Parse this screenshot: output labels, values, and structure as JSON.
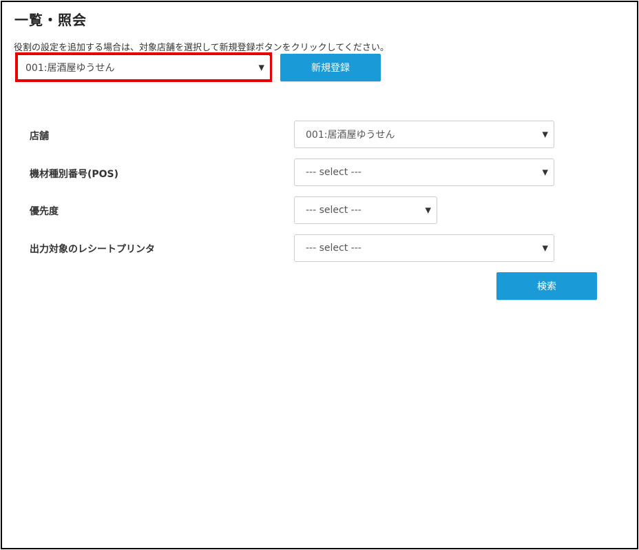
{
  "page": {
    "title": "一覧・照会",
    "instruction": "役割の設定を追加する場合は、対象店舗を選択して新規登録ボタンをクリックしてください。"
  },
  "top_bar": {
    "store_select_value": "001:居酒屋ゆうせん",
    "new_button_label": "新規登録"
  },
  "search_form": {
    "fields": [
      {
        "label": "店舗",
        "value": "001:居酒屋ゆうせん"
      },
      {
        "label": "機材種別番号(POS)",
        "value": "--- select ---"
      },
      {
        "label": "優先度",
        "value": "--- select ---"
      },
      {
        "label": "出力対象のレシートプリンタ",
        "value": "--- select ---"
      }
    ],
    "search_button_label": "検索"
  },
  "icons": {
    "dropdown": "chevron-down-icon"
  },
  "colors": {
    "primary_button": "#1a9ad6",
    "highlight": "#e60000"
  }
}
